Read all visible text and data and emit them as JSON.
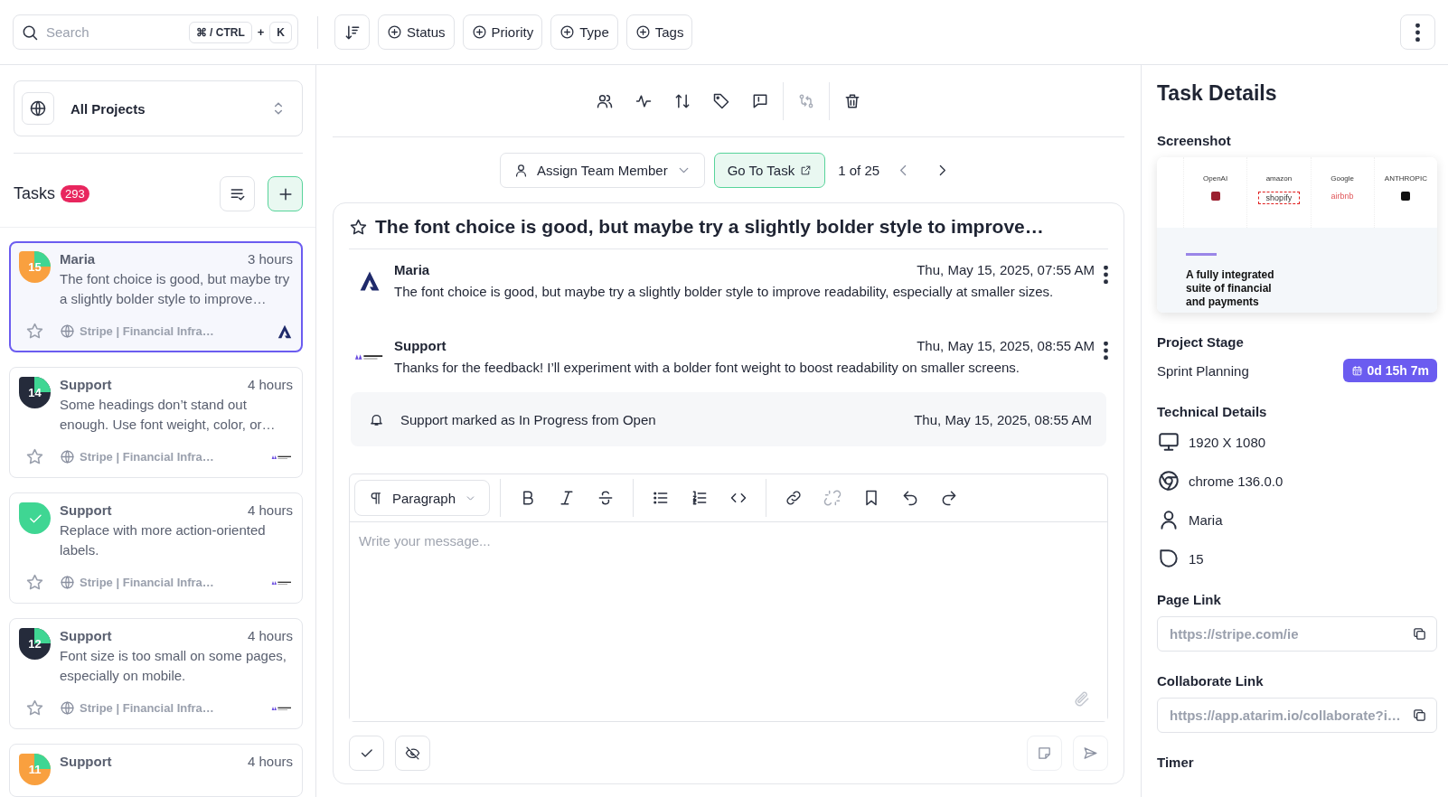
{
  "search": {
    "placeholder": "Search",
    "keys": [
      "⌘ / CTRL",
      "K"
    ],
    "plus": "+"
  },
  "filters": [
    "Status",
    "Priority",
    "Type",
    "Tags"
  ],
  "project_selector": {
    "label": "All Projects"
  },
  "tasks_header": {
    "title": "Tasks",
    "count": "293"
  },
  "task_cards": [
    {
      "kind": "number",
      "badge": "15",
      "color": "#f9a03f",
      "author": "Maria",
      "time": "3 hours",
      "text": "The font choice is good, but maybe try a slightly bolder style to improve…",
      "project": "Stripe | Financial Infra…",
      "starred": false,
      "selected": true,
      "logo": {
        "kind": "letter"
      }
    },
    {
      "kind": "number",
      "badge": "14",
      "color": "#252b3b",
      "author": "Support",
      "time": "4 hours",
      "text": "Some headings don’t stand out enough. Use font weight, color, or…",
      "project": "Stripe | Financial Infra…",
      "starred": false,
      "selected": false,
      "logo": {
        "kind": "wordmark"
      }
    },
    {
      "kind": "done",
      "color": "#3fd693",
      "author": "Support",
      "time": "4 hours",
      "text": "Replace with more action-oriented labels.",
      "project": "Stripe | Financial Infra…",
      "starred": false,
      "selected": false,
      "logo": {
        "kind": "wordmark"
      }
    },
    {
      "kind": "number",
      "badge": "12",
      "color": "#252b3b",
      "author": "Support",
      "time": "4 hours",
      "text": "Font size is too small on some pages, especially on mobile.",
      "project": "Stripe | Financial Infra…",
      "starred": false,
      "selected": false,
      "logo": {
        "kind": "wordmark"
      }
    },
    {
      "kind": "number",
      "badge": "11",
      "color": "#f9a03f",
      "author": "Support",
      "time": "4 hours",
      "selected": false
    }
  ],
  "assign": {
    "label": "Assign Team Member"
  },
  "go_to_task": {
    "label": "Go To Task"
  },
  "pager": {
    "text": "1 of 25"
  },
  "task": {
    "title": "The font choice is good, but maybe try a slightly bolder style to improve…",
    "starred": false
  },
  "messages": [
    {
      "author": "Maria",
      "time": "Thu, May 15, 2025, 07:55 AM",
      "text": "The font choice is good, but maybe try a slightly bolder style to improve readability, especially at smaller sizes.",
      "logo": {
        "kind": "letter"
      }
    },
    {
      "author": "Support",
      "time": "Thu, May 15, 2025, 08:55 AM",
      "text": "Thanks for the feedback! I’ll experiment with a bolder font weight to boost readability on smaller screens.",
      "logo": {
        "kind": "wordmark"
      }
    }
  ],
  "activity": {
    "text": "Support marked as In Progress from Open",
    "time": "Thu, May 15, 2025, 08:55 AM"
  },
  "editor": {
    "block_style": "Paragraph",
    "placeholder": "Write your message..."
  },
  "details": {
    "title": "Task Details",
    "screenshot": {
      "heading": "Screenshot",
      "logos": [
        {
          "name": "OpenAI"
        },
        {
          "name": "amazon",
          "sub": "shopify"
        },
        {
          "name": "Google",
          "sub": "airbnb"
        },
        {
          "name": "ANTHROPIC"
        }
      ],
      "headline": "A fully integrated suite of financial and payments"
    },
    "project_stage": {
      "heading": "Project Stage",
      "stage": "Sprint Planning",
      "duration": "0d 15h 7m"
    },
    "technical": {
      "heading": "Technical Details",
      "items": [
        {
          "kind": "monitor",
          "text": "1920 X 1080"
        },
        {
          "kind": "browser",
          "text": "chrome 136.0.0"
        },
        {
          "kind": "user",
          "text": "Maria"
        },
        {
          "kind": "shape",
          "text": "15"
        }
      ]
    },
    "page_link": {
      "heading": "Page Link",
      "value": "https://stripe.com/ie"
    },
    "collaborate_link": {
      "heading": "Collaborate Link",
      "value": "https://app.atarim.io/collaborate?i…"
    },
    "timer": {
      "heading": "Timer"
    }
  }
}
